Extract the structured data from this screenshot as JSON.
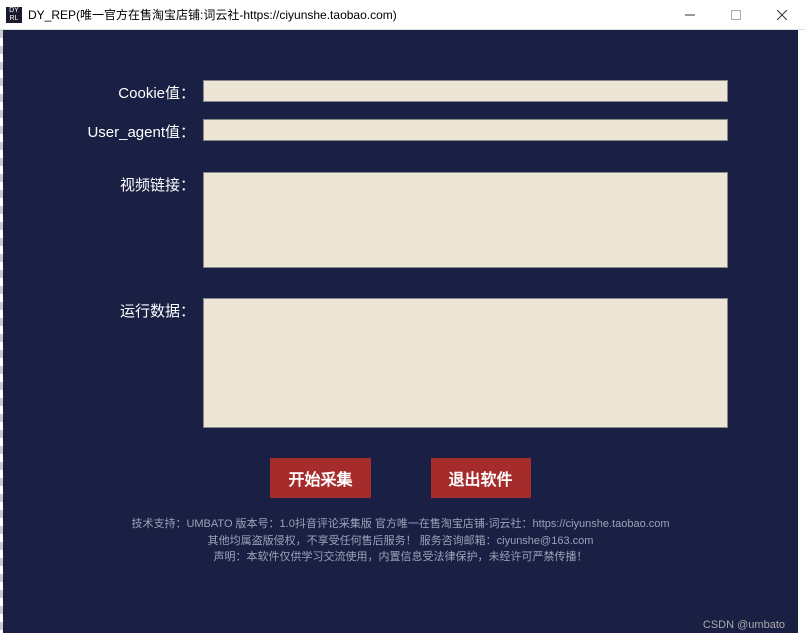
{
  "window": {
    "title": "DY_REP(唯一官方在售淘宝店铺:词云社-https://ciyunshe.taobao.com)",
    "icon_text_top": "DY",
    "icon_text_bottom": "RL"
  },
  "labels": {
    "cookie": "Cookie值：",
    "user_agent": "User_agent值：",
    "video_link": "视频链接：",
    "run_data": "运行数据："
  },
  "inputs": {
    "cookie_value": "",
    "user_agent_value": "",
    "video_link_value": "",
    "run_data_value": ""
  },
  "buttons": {
    "start": "开始采集",
    "exit": "退出软件"
  },
  "footer": {
    "line1": "技术支持：UMBATO   版本号：1.0抖音评论采集版   官方唯一在售淘宝店铺-词云社：https://ciyunshe.taobao.com",
    "line2": "其他均属盗版侵权，不享受任何售后服务！  服务咨询邮箱：ciyunshe@163.com",
    "line3": "声明：本软件仅供学习交流使用，内置信息受法律保护，未经许可严禁传播！"
  },
  "watermark": "CSDN @umbato"
}
